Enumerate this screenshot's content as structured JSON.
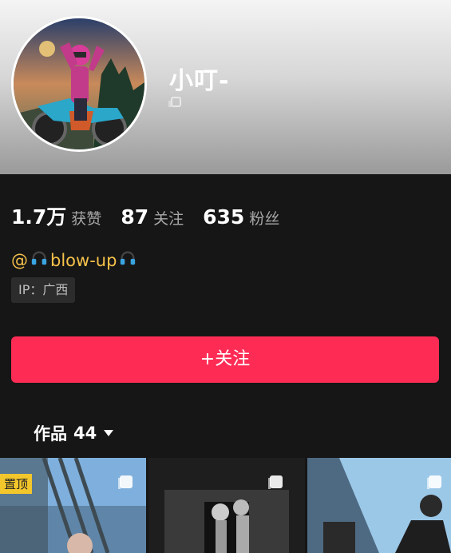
{
  "profile": {
    "name": "小叮-"
  },
  "stats": [
    {
      "num": "1.7万",
      "label": "获赞"
    },
    {
      "num": "87",
      "label": "关注"
    },
    {
      "num": "635",
      "label": "粉丝"
    }
  ],
  "bio": {
    "handle_prefix": "@",
    "handle_text": "blow-up",
    "icon": "headphones-icon"
  },
  "ip": {
    "label": "IP：广西"
  },
  "follow_button": {
    "label": "+关注",
    "color": "#fe2c55"
  },
  "works_tab": {
    "label": "作品",
    "count": "44"
  },
  "grid": {
    "pinned_label": "置顶"
  }
}
